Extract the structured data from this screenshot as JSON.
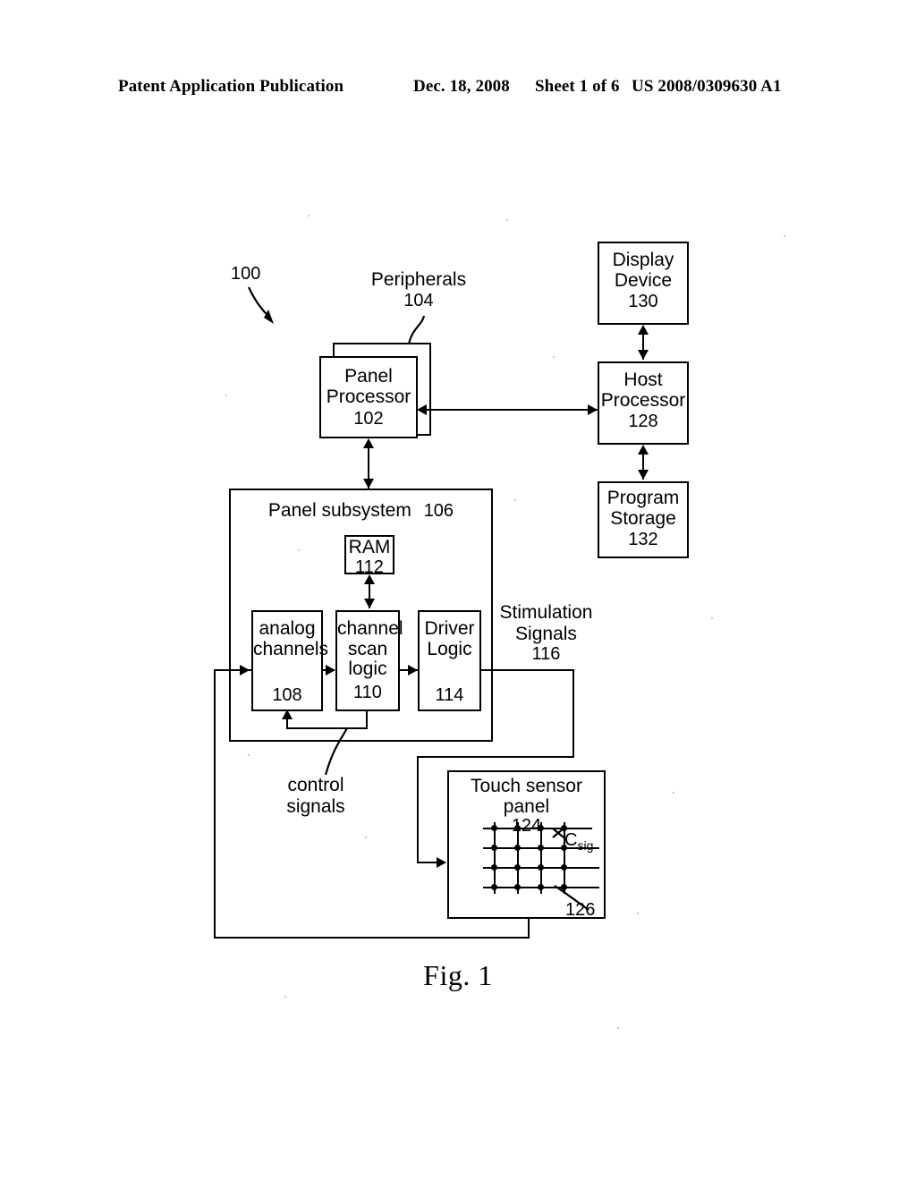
{
  "header": {
    "publication": "Patent Application Publication",
    "date": "Dec. 18, 2008",
    "sheet": "Sheet 1 of 6",
    "patent_number": "US 2008/0309630 A1"
  },
  "figure": {
    "caption": "Fig. 1",
    "system_ref": "100"
  },
  "blocks": {
    "peripherals": {
      "label": "Peripherals",
      "ref": "104"
    },
    "panel_processor": {
      "line1": "Panel",
      "line2": "Processor",
      "ref": "102"
    },
    "display_device": {
      "line1": "Display",
      "line2": "Device",
      "ref": "130"
    },
    "host_processor": {
      "line1": "Host",
      "line2": "Processor",
      "ref": "128"
    },
    "program_storage": {
      "line1": "Program",
      "line2": "Storage",
      "ref": "132"
    },
    "panel_subsystem": {
      "label": "Panel subsystem",
      "ref": "106"
    },
    "ram": {
      "label": "RAM",
      "ref": "112"
    },
    "analog_channels": {
      "line1": "analog",
      "line2": "channels",
      "ref": "108"
    },
    "channel_scan_logic": {
      "line1": "channel",
      "line2": "scan",
      "line3": "logic",
      "ref": "110"
    },
    "driver_logic": {
      "line1": "Driver",
      "line2": "Logic",
      "ref": "114"
    },
    "touch_sensor_panel": {
      "label": "Touch sensor panel",
      "ref": "124"
    }
  },
  "annotations": {
    "stimulation_signals": {
      "line1": "Stimulation",
      "line2": "Signals",
      "ref": "116"
    },
    "control_signals": {
      "line1": "control",
      "line2": "signals"
    },
    "csig": {
      "symbol": "C",
      "subscript": "sig"
    },
    "electrode_ref": "126"
  },
  "colors": {
    "ink": "#000000",
    "paper": "#ffffff"
  }
}
